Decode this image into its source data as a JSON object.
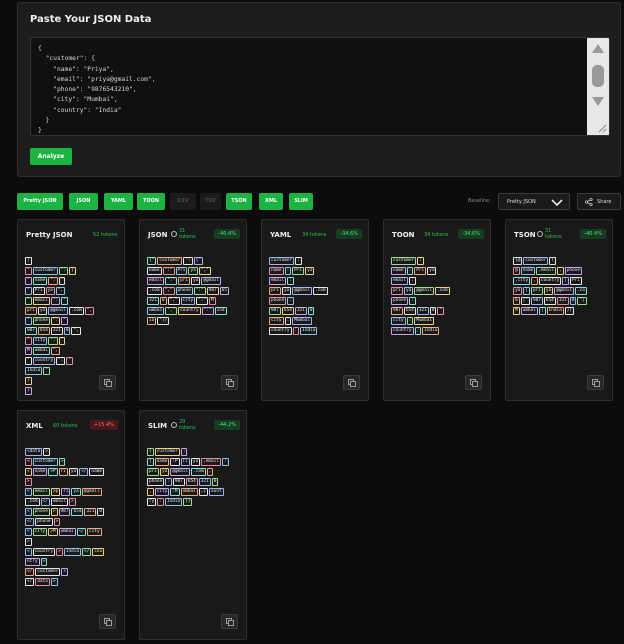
{
  "input": {
    "title": "Paste Your JSON Data",
    "json_text": "{\n  \"customer\": {\n    \"name\": \"Priya\",\n    \"email\": \"priya@gmail.com\",\n    \"phone\": \"9876543210\",\n    \"city\": \"Mumbai\",\n    \"country\": \"India\"\n  }\n}",
    "analyze_label": "Analyze"
  },
  "formats": [
    {
      "label": "Pretty JSON",
      "active": true
    },
    {
      "label": "JSON",
      "active": true
    },
    {
      "label": "YAML",
      "active": true
    },
    {
      "label": "TOON",
      "active": true
    },
    {
      "label": "CSV",
      "active": false
    },
    {
      "label": "TSV",
      "active": false
    },
    {
      "label": "TSON",
      "active": true
    },
    {
      "label": "XML",
      "active": true
    },
    {
      "label": "SLIM",
      "active": true
    }
  ],
  "baseline": {
    "label": "Baseline:",
    "value": "Pretty JSON"
  },
  "share_label": "Share",
  "colors": {
    "accent": "#1bb341",
    "positive": "#55e07a",
    "negative": "#ff6c6c"
  },
  "icons": {
    "copy": "copy-icon",
    "clock": "clock-icon",
    "share": "share-icon",
    "chevron": "chevron-down-icon"
  },
  "cards": [
    {
      "name": "Pretty JSON",
      "tokens": "52 tokens",
      "badge": "",
      "clock": false,
      "lines": [
        [
          "{"
        ],
        [
          "\"",
          "customer",
          "\":",
          "{"
        ],
        [
          "\"",
          "name",
          "\":",
          "\""
        ],
        [
          "\"",
          "Pri",
          "ya",
          "\","
        ],
        [
          "\"",
          "email",
          "\":",
          "\""
        ],
        [
          "pri",
          "ya",
          "@gmail",
          ".com",
          "\","
        ],
        [
          "\"",
          "phone",
          "\":",
          "\""
        ],
        [
          "987",
          "654",
          "321",
          "0",
          "\","
        ],
        [
          "\"",
          "city",
          "\":",
          "\""
        ],
        [
          "M",
          "umbai",
          "\","
        ],
        [
          "\"",
          "country",
          "\":",
          "\""
        ],
        [
          "India",
          "\""
        ],
        [
          "}"
        ],
        [
          "}"
        ]
      ]
    },
    {
      "name": "JSON",
      "tokens": "31 tokens",
      "badge": "-40.4%",
      "clock": true,
      "lines": [
        [
          "{\"",
          "customer",
          "\":",
          "{\""
        ],
        [
          "name",
          "\":\"",
          "Pri",
          "ya",
          "\",\""
        ],
        [
          "email",
          "\":\"",
          "pri",
          "ya",
          "@gmail"
        ],
        [
          ".com",
          "\",\"",
          "phone",
          "\":\"",
          "987",
          "65"
        ],
        [
          "321",
          "0",
          "\",\"",
          "city",
          "\":\"",
          "M"
        ],
        [
          "umbai",
          "\",\"",
          "country",
          "\":\"",
          "Ind"
        ],
        [
          "ia",
          "\"}}"
        ]
      ]
    },
    {
      "name": "YAML",
      "tokens": "34 tokens",
      "badge": "-34.6%",
      "clock": false,
      "lines": [
        [
          "customer",
          ":"
        ],
        [
          "name",
          ":",
          "Pri",
          "ya"
        ],
        [
          "email",
          ":"
        ],
        [
          "pri",
          "ya",
          "@gmail",
          ".com"
        ],
        [
          "phone",
          ":"
        ],
        [
          "987",
          "654",
          "321",
          "0"
        ],
        [
          "city",
          ":",
          "Mumbai"
        ],
        [
          "country",
          ":",
          "India"
        ]
      ]
    },
    {
      "name": "TOON",
      "tokens": "34 tokens",
      "badge": "-34.6%",
      "clock": false,
      "lines": [
        [
          "customer",
          ":"
        ],
        [
          "name",
          ":",
          "Pri",
          "ya"
        ],
        [
          "email",
          ":"
        ],
        [
          "pri",
          "ya",
          "@gmail",
          ".com"
        ],
        [
          "phone",
          ":"
        ],
        [
          "987",
          "654",
          "321",
          "0",
          "\""
        ],
        [
          "city",
          ":",
          "Mumbai"
        ],
        [
          "country",
          ":",
          "India"
        ]
      ]
    },
    {
      "name": "TSON",
      "tokens": "31 tokens",
      "badge": "-40.4%",
      "clock": true,
      "lines": [
        [
          "{@",
          "customer",
          "("
        ],
        [
          "@",
          "name",
          ",email",
          ",",
          "phone"
        ],
        [
          ",city",
          ",",
          "country",
          "|",
          "Pri"
        ],
        [
          "ya",
          "|",
          "pri",
          "ya",
          "@gmail",
          ".co"
        ],
        [
          "m",
          "|\"",
          "987",
          "654",
          "321",
          "0",
          "\"|"
        ],
        [
          "M",
          "umbai",
          "|",
          "India",
          "})"
        ]
      ]
    },
    {
      "name": "XML",
      "tokens": "60 tokens",
      "badge": "+15.4%",
      "clock": false,
      "lines": [
        [
          "<data",
          ">"
        ],
        [
          "<",
          "customer",
          ">"
        ],
        [
          "<",
          "name",
          ">P",
          "ri",
          "ya",
          "</",
          "name"
        ],
        [
          ">"
        ],
        [
          "<",
          "email",
          ">p",
          "ri",
          "ya",
          "@gmail"
        ],
        [
          ".com",
          "</",
          "email",
          ">"
        ],
        [
          "<",
          "phone",
          ">",
          "987",
          "654",
          "321",
          "0"
        ],
        [
          "</",
          "phone",
          ">"
        ],
        [
          "<",
          "city",
          ">M",
          "umbai",
          "</",
          "city"
        ],
        [
          ">"
        ],
        [
          "<",
          "country",
          ">",
          "India",
          "</",
          "cou"
        ],
        [
          "ntry",
          ">"
        ],
        [
          "</",
          "customer",
          ">"
        ],
        [
          "</",
          "data",
          ">"
        ]
      ]
    },
    {
      "name": "SLIM",
      "tokens": "29 tokens",
      "badge": "-44.2%",
      "clock": true,
      "lines": [
        [
          "{",
          "customer",
          ":"
        ],
        [
          "{",
          "name",
          ":P",
          "ri",
          "ya",
          ",email",
          ":"
        ],
        [
          "pri",
          "ya",
          "@gmail",
          ".com",
          ","
        ],
        [
          "phone",
          ":",
          "987",
          "654",
          "321",
          "0"
        ],
        [
          ",",
          "city",
          ":M",
          "umbai",
          ",c",
          "ount"
        ],
        [
          "ry",
          ":",
          "India",
          "}}"
        ]
      ]
    }
  ]
}
